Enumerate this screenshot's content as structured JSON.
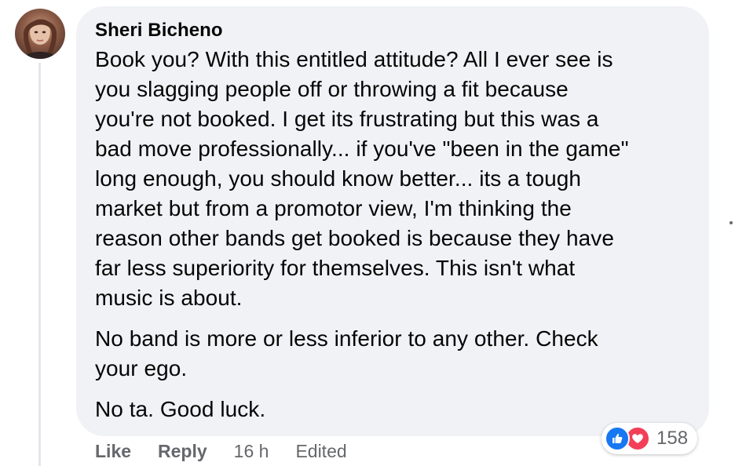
{
  "comment": {
    "author": "Sheri Bicheno",
    "paragraphs": [
      "Book you? With this entitled attitude? All I ever see is\nyou slagging people off or throwing a fit because\nyou're not booked. I get its frustrating but this was a\nbad move professionally... if you've \"been in the game\"\nlong enough, you should know better... its a tough\nmarket but from a promotor view, I'm thinking the\nreason other bands get booked is because they have\nfar less superiority for themselves. This isn't what\nmusic is about.",
      "No band is more or less inferior to any other. Check\nyour ego.",
      "No ta. Good luck."
    ]
  },
  "actions": {
    "like": "Like",
    "reply": "Reply",
    "time": "16 h",
    "edited": "Edited"
  },
  "reactions": {
    "count": "158",
    "icons": [
      "like-reaction-icon",
      "love-reaction-icon"
    ]
  },
  "colors": {
    "bubble": "#f0f2f5",
    "text": "#050505",
    "muted": "#65676b",
    "like_blue": "#1877f2",
    "love_red": "#f33e58"
  }
}
